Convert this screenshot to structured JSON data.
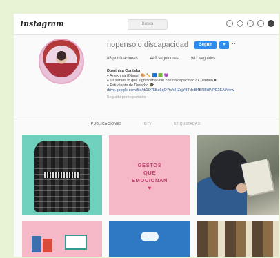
{
  "header": {
    "logo": "Instagram",
    "search_placeholder": "Busca",
    "icons": [
      "home-icon",
      "explore-icon",
      "compass-icon",
      "heart-icon",
      "profile-avatar-icon"
    ]
  },
  "profile": {
    "username": "nopensolo.discapacidad",
    "follow_label": "Seguir",
    "more_label": "···",
    "stats": {
      "posts": "88 publicaciones",
      "followers": "449 seguidores",
      "following": "981 seguidos"
    },
    "bio": {
      "name": "Dominica Contalor",
      "line1": "♦ Artekhnia (Obras) 🎨 ✏️ 🟦 🟩 💜",
      "line2": "♦ Tu sabias lo que significaba vivir con discapacidad? Cuentalo ♥",
      "line3": "♦ Estudiante de Derecho 🎓",
      "link": "drive.google.com/file/d/1O75Bs6qO7ts/sHZxjY8TdsiB4BRBi8NPE2EAi/view",
      "followed_by": "Seguido por nopensolo"
    }
  },
  "tabs": [
    "PUBLICACIONES",
    "IGTV",
    "ETIQUETADAS"
  ],
  "posts": [
    {
      "id": "backpack"
    },
    {
      "id": "gestos",
      "lines": [
        "GESTOS",
        "QUE",
        "EMOCIONAN"
      ]
    },
    {
      "id": "reading"
    },
    {
      "id": "illustration"
    },
    {
      "id": "cloud"
    },
    {
      "id": "bookshelf"
    }
  ],
  "colors": {
    "accent": "#2d8cf0",
    "pink": "#f4b8c7",
    "teal": "#6fd0bd"
  }
}
